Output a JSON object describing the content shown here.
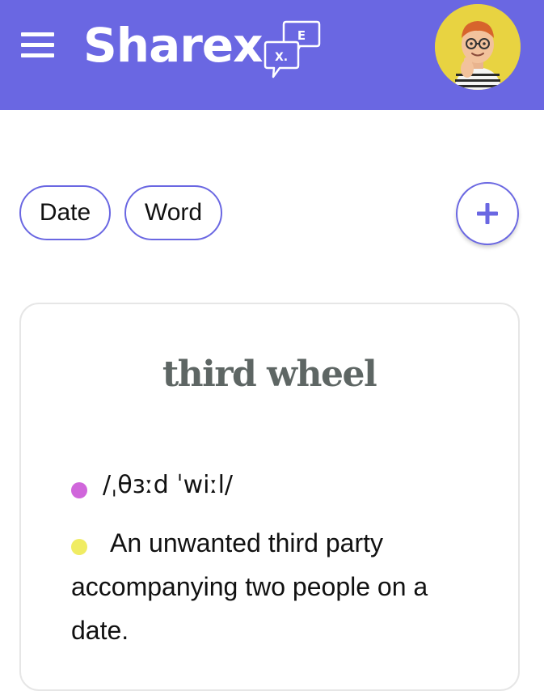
{
  "app": {
    "name": "Sharex.",
    "icon": "chat-bubbles-icon",
    "icon_letters": [
      "E",
      "X."
    ]
  },
  "header": {
    "menu_icon": "hamburger-menu-icon",
    "avatar": "user-avatar"
  },
  "filters": {
    "date_label": "Date",
    "word_label": "Word",
    "add_icon": "plus-icon"
  },
  "card": {
    "word": "third wheel",
    "pronunciation": "/ˌθɜːd ˈwiːl/",
    "definition": "An unwanted third party accompanying two people on a date."
  },
  "colors": {
    "brand": "#6A67E2",
    "pronunciation_dot": "#D066DB",
    "definition_dot": "#F0EC63",
    "title_text": "#5E6664",
    "avatar_bg": "#E8D341"
  }
}
